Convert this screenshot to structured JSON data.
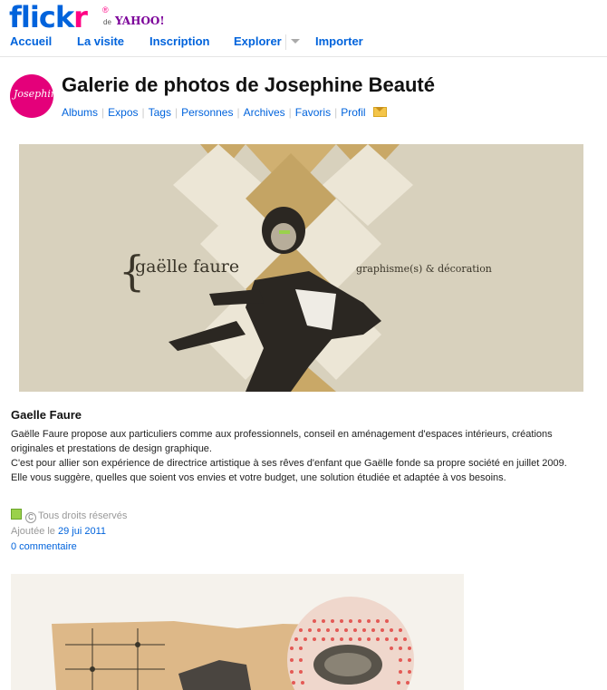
{
  "brand": {
    "flickr_part1": "flick",
    "flickr_part2": "r",
    "registered": "®",
    "de": "de",
    "yahoo": "YAHOO!"
  },
  "nav": {
    "items": [
      "Accueil",
      "La visite",
      "Inscription",
      "Explorer",
      "Importer"
    ]
  },
  "header": {
    "avatar_text": "Josephine",
    "title": "Galerie de photos de Josephine Beauté",
    "links": [
      "Albums",
      "Expos",
      "Tags",
      "Personnes",
      "Archives",
      "Favoris",
      "Profil"
    ]
  },
  "banner": {
    "brace": "{",
    "name": "gaëlle faure",
    "tagline": "graphisme(s) & décoration"
  },
  "photo": {
    "title": "Gaelle Faure",
    "description": [
      "Gaëlle Faure propose aux particuliers comme aux professionnels, conseil en aménagement d'espaces intérieurs, créations originales et prestations de design graphique.",
      "C'est pour allier son expérience de directrice artistique à ses rêves d'enfant que Gaëlle fonde sa propre société en juillet 2009.",
      "Elle vous suggère, quelles que soient vos envies et votre budget, une solution étudiée et adaptée à vos besoins."
    ],
    "license": "Tous droits réservés",
    "cc_glyph": "C",
    "added_prefix": "Ajoutée le",
    "added_date": "29 jui 2011",
    "comments": "0 commentaire"
  },
  "colors": {
    "flickr_blue": "#0063dc",
    "flickr_pink": "#ff0084",
    "yahoo_purple": "#7b0099",
    "link": "#0063dc"
  }
}
